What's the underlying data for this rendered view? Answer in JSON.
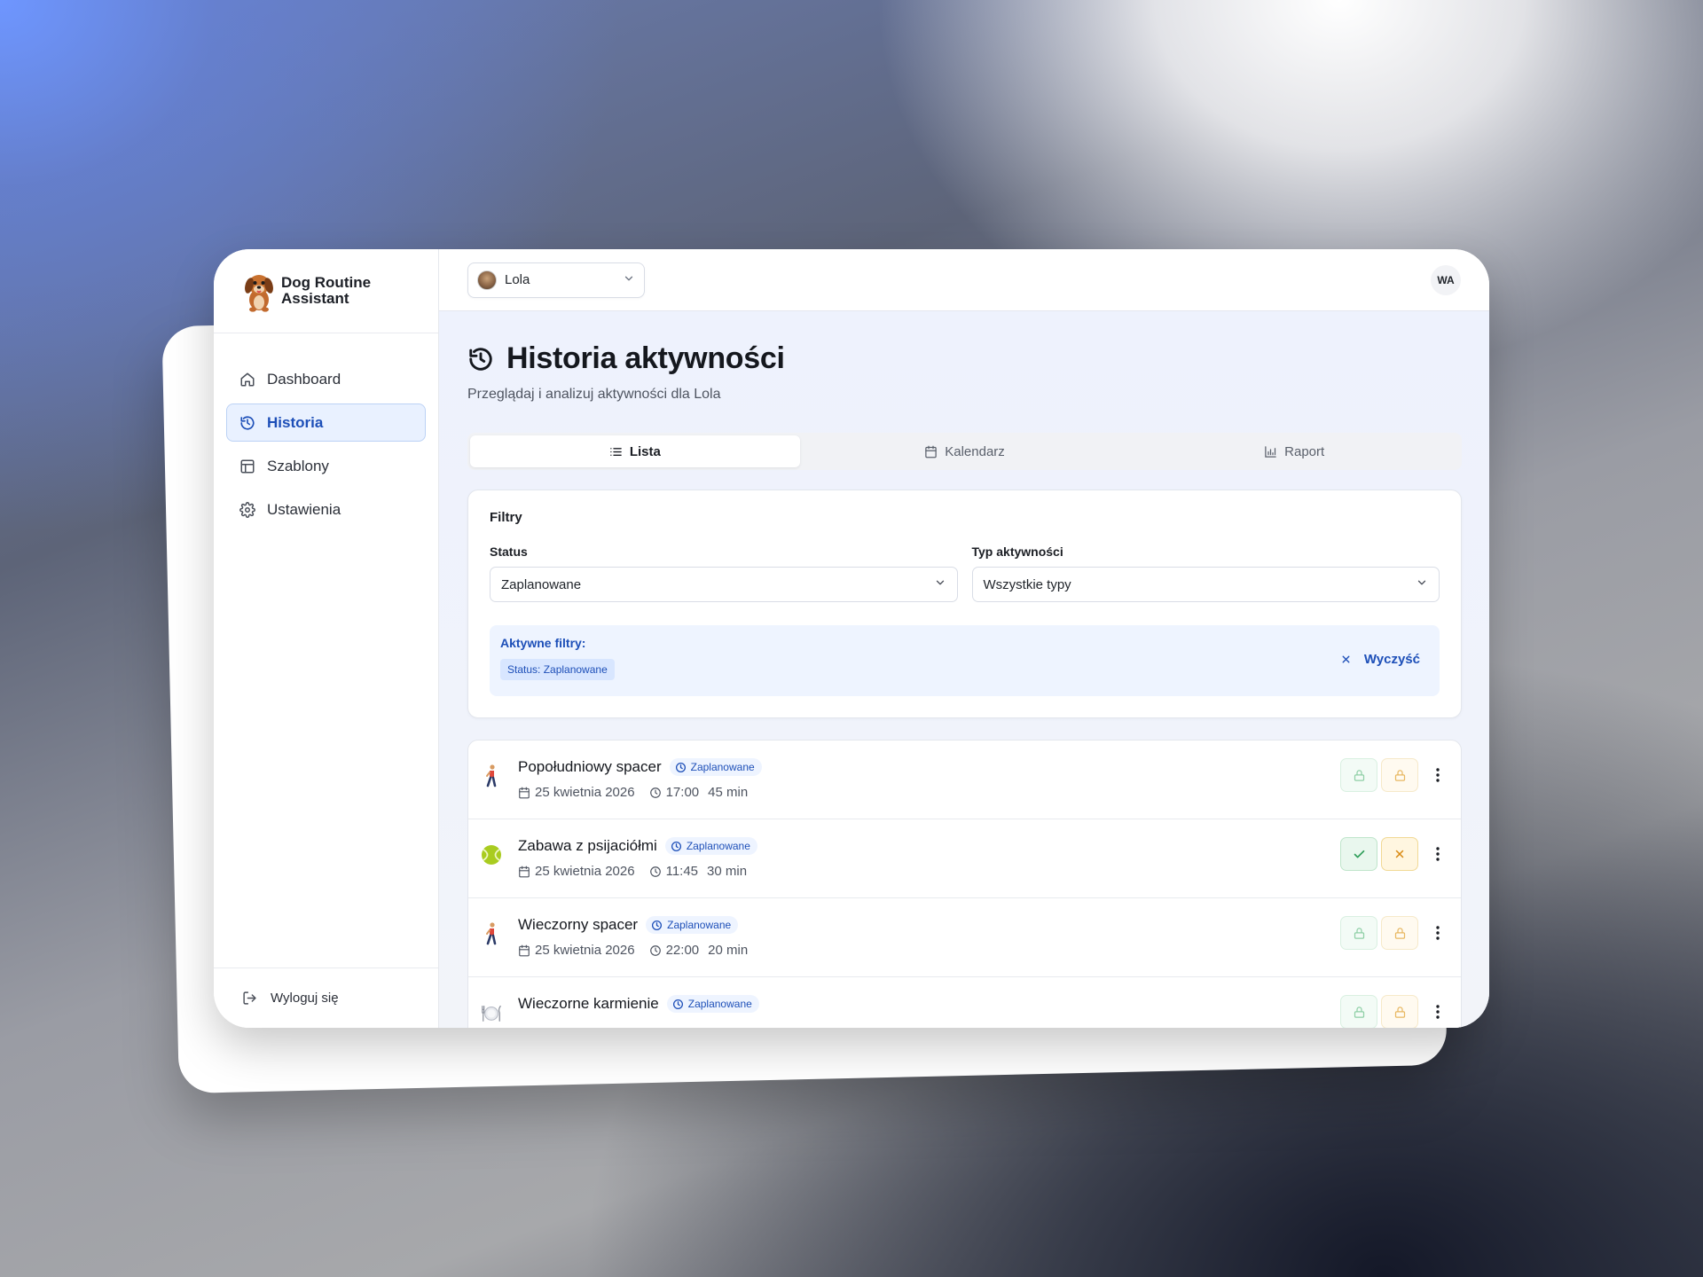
{
  "app": {
    "brand": "Dog Routine Assistant"
  },
  "sidebar": {
    "items": [
      {
        "label": "Dashboard",
        "icon": "home-icon"
      },
      {
        "label": "Historia",
        "icon": "history-icon",
        "active": true
      },
      {
        "label": "Szablony",
        "icon": "layout-icon"
      },
      {
        "label": "Ustawienia",
        "icon": "gear-icon"
      }
    ],
    "logout_label": "Wyloguj się"
  },
  "topbar": {
    "dog_name": "Lola",
    "user_initials": "WA"
  },
  "page": {
    "title": "Historia aktywności",
    "subtitle": "Przeglądaj i analizuj aktywności dla Lola"
  },
  "tabs": [
    {
      "label": "Lista",
      "icon": "list-icon",
      "active": true
    },
    {
      "label": "Kalendarz",
      "icon": "calendar-icon"
    },
    {
      "label": "Raport",
      "icon": "bar-chart-icon"
    }
  ],
  "filters": {
    "title": "Filtry",
    "status_label": "Status",
    "status_value": "Zaplanowane",
    "type_label": "Typ aktywności",
    "type_value": "Wszystkie typy",
    "active_label": "Aktywne filtry:",
    "active_chip": "Status: Zaplanowane",
    "clear_label": "Wyczyść"
  },
  "activities": [
    {
      "title": "Popołudniowy spacer",
      "status": "Zaplanowane",
      "date": "25 kwietnia 2026",
      "time": "17:00",
      "duration": "45 min",
      "icon": "walking-person-icon",
      "actions": "locked"
    },
    {
      "title": "Zabawa z psijaciółmi",
      "status": "Zaplanowane",
      "date": "25 kwietnia 2026",
      "time": "11:45",
      "duration": "30 min",
      "icon": "tennis-ball-icon",
      "actions": "open"
    },
    {
      "title": "Wieczorny spacer",
      "status": "Zaplanowane",
      "date": "25 kwietnia 2026",
      "time": "22:00",
      "duration": "20 min",
      "icon": "walking-person-icon",
      "actions": "locked"
    },
    {
      "title": "Wieczorne karmienie",
      "status": "Zaplanowane",
      "date": "",
      "time": "",
      "duration": "",
      "icon": "plate-cutlery-icon",
      "actions": "locked"
    }
  ],
  "colors": {
    "accent": "#1d4fb8",
    "active_nav_bg": "#e9f1ff",
    "success": "#2f9e5a",
    "warning": "#d98a12"
  }
}
